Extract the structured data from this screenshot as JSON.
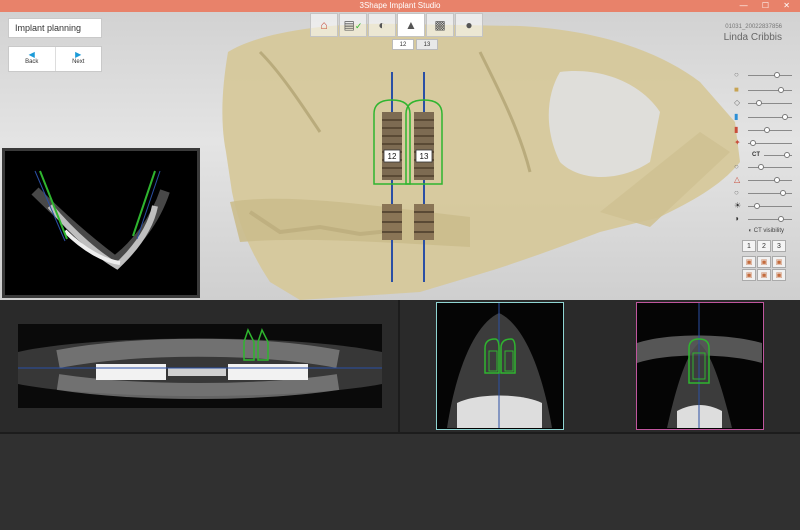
{
  "app": {
    "title": "3Shape Implant Studio",
    "window_buttons": "— ☐ ✕"
  },
  "workflow": {
    "step_label": "Implant planning",
    "back_label": "Back",
    "next_label": "Next"
  },
  "patient": {
    "id": "01031_20022837856",
    "name": "Linda Cribbis"
  },
  "implant_tabs": [
    "12",
    "13"
  ],
  "implants": {
    "left_label": "12",
    "right_label": "13"
  },
  "side_panel": {
    "ct_label": "CT",
    "ct_visibility_label": "CT visibility",
    "view_buttons": [
      "1",
      "2",
      "3"
    ]
  },
  "colors": {
    "titlebar": "#e8826a",
    "bone": "#d6c89b",
    "implant_outline": "#2fb52f",
    "axis_line": "#2a4fa5",
    "section_a_frame": "#8fd4d2",
    "section_b_frame": "#c0569e",
    "nav_arrow": "#1c9bd8"
  }
}
